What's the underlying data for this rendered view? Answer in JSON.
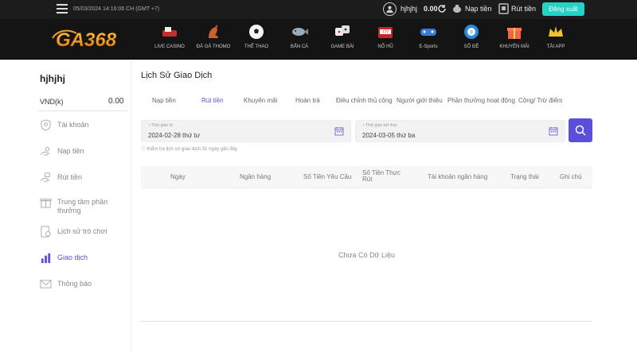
{
  "topbar": {
    "datetime": "05/03/2024 14:16:06 CH (GMT +7)",
    "username": "hjhjhj",
    "balance": "0.00",
    "deposit": "Nạp tiền",
    "withdraw": "Rút tiền",
    "logout": "Đăng xuất",
    "logout_color": "#22d3c6"
  },
  "logo": {
    "text": "GA368",
    "color": "#f0a020"
  },
  "nav": [
    {
      "label": "LIVE CASINO",
      "icon": "casino-icon"
    },
    {
      "label": "ĐÁ GÀ THOMO",
      "icon": "rooster-icon"
    },
    {
      "label": "THỂ THAO",
      "icon": "soccer-ball-icon"
    },
    {
      "label": "BẮN CÁ",
      "icon": "fish-icon"
    },
    {
      "label": "GAME BÀI",
      "icon": "dice-icon"
    },
    {
      "label": "NỔ HŨ",
      "icon": "slot-machine-icon"
    },
    {
      "label": "E-Sports",
      "icon": "gamepad-icon"
    },
    {
      "label": "SỐ ĐỀ",
      "icon": "lottery-ball-icon"
    },
    {
      "label": "KHUYẾN MÃI",
      "icon": "gift-icon"
    },
    {
      "label": "TẢI APP",
      "icon": "crown-icon"
    }
  ],
  "sidebar": {
    "username": "hjhjhj",
    "currency": "VND(k)",
    "balance": "0.00",
    "items": [
      {
        "label": "Tài khoản",
        "icon": "user-shield-icon"
      },
      {
        "label": "Nạp tiền",
        "icon": "deposit-hand-icon"
      },
      {
        "label": "Rút tiền",
        "icon": "withdraw-hand-icon"
      },
      {
        "label": "Trung tâm phần thưởng",
        "icon": "reward-gift-icon"
      },
      {
        "label": "Lịch sử trò chơi",
        "icon": "history-icon"
      },
      {
        "label": "Giao dịch",
        "icon": "transaction-chart-icon"
      },
      {
        "label": "Thông báo",
        "icon": "mail-icon"
      }
    ],
    "active_color": "#5b4fd9"
  },
  "main": {
    "title": "Lịch Sử Giao Dịch",
    "tabs": [
      "Nạp tiền",
      "Rút tiền",
      "Khuyến mãi",
      "Hoàn trả",
      "Điều chỉnh thủ công",
      "Người giới thiệu",
      "Phần thưởng hoạt động",
      "Cộng/ Trừ điểm"
    ],
    "active_tab": "Rút tiền",
    "start_label": "Thời gian từ",
    "start_value": "2024-02-28 thứ tư",
    "end_label": "Thời gian kết thúc",
    "end_value": "2024-03-05 thứ ba",
    "hint": "ⓘ Kiểm tra lịch sử giao dịch 31 ngày gần đây",
    "columns": [
      "Ngày",
      "Ngân hàng",
      "Số Tiền Yêu Cầu",
      "Số Tiền Thực Rút",
      "Tài khoản ngân hàng",
      "Trạng thái",
      "Ghi chú"
    ],
    "empty": "Chưa Có Dữ Liệu"
  }
}
